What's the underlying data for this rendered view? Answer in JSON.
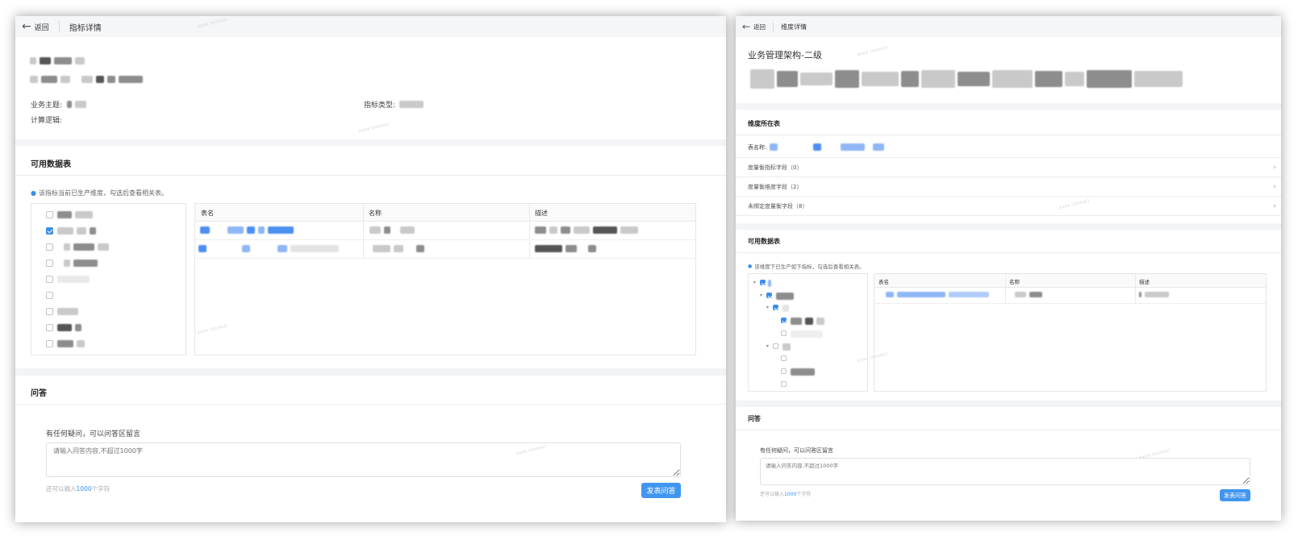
{
  "left": {
    "header": {
      "back_label": "返回",
      "title": "指标详情"
    },
    "fields": {
      "business_label": "业务主题:",
      "type_label": "指标类型:",
      "logic_label": "计算逻辑:"
    },
    "tables_section": {
      "title": "可用数据表",
      "info": "该指标当前已生产维度，勾选后查看相关表。",
      "columns": [
        "表名",
        "名称",
        "描述"
      ]
    },
    "qa": {
      "title": "问答",
      "prompt": "有任何疑问，可以问答区留言",
      "placeholder": "请输入问答内容,不超过1000字",
      "hint_prefix": "还可以输入",
      "hint_count": "1000",
      "hint_suffix": "个字符",
      "submit": "发表问答"
    }
  },
  "right": {
    "header": {
      "back_label": "返回",
      "title": "维度详情"
    },
    "page_title": "业务管理架构-二级",
    "dim_section": {
      "title": "维度所在表",
      "table_label": "表名称:",
      "groups": [
        "度量衡指标字段（0）",
        "度量衡维度字段（2）",
        "未绑定度量衡字段（8）"
      ]
    },
    "tables_section": {
      "title": "可用数据表",
      "info": "该维度下已生产如下指标，勾选后查看相关表。",
      "columns": [
        "表名",
        "名称",
        "描述"
      ]
    },
    "qa": {
      "title": "问答",
      "prompt": "有任何疑问，可以问答区留言",
      "placeholder": "请输入问答内容,不超过1000字",
      "hint_prefix": "还可以输入",
      "hint_count": "1000",
      "hint_suffix": "个字符",
      "submit": "发表问答"
    }
  },
  "colors": {
    "accent": "#3a8ee6",
    "button": "#4096f0",
    "section_gap": "#f3f4f6"
  },
  "icons": {
    "back": "arrow-left-icon",
    "info": "info-circle-icon",
    "chevron": "chevron-right-icon"
  }
}
